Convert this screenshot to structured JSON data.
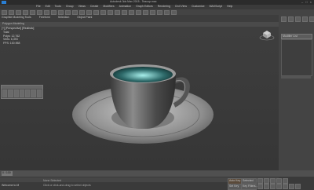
{
  "titlebar": {
    "title": "Autodesk 3ds Max 2015 - Teacup.max"
  },
  "menu": [
    "File",
    "Edit",
    "Tools",
    "Group",
    "Views",
    "Create",
    "Modifiers",
    "Animation",
    "Graph Editors",
    "Rendering",
    "Civil View",
    "Customize",
    "MAXScript",
    "Help"
  ],
  "ribbon": {
    "tabs": [
      "Graphite Modeling Tools",
      "Freeform",
      "Selection",
      "Object Paint"
    ],
    "sub_label": "Polygon Modeling"
  },
  "viewport": {
    "label": "[+] [Perspective] [Realistic]",
    "stats": [
      {
        "key": "Total",
        "value": ""
      },
      {
        "key": "Polys:",
        "value": "12,762"
      },
      {
        "key": "Verts:",
        "value": "6,393"
      },
      {
        "key": "FPS:",
        "value": "100.958"
      }
    ]
  },
  "command_panel": {
    "dropdown": "Modifier List"
  },
  "statusbar": {
    "timeline_position": "0 / 100",
    "welcome": "Welcome to M",
    "prompt": "Click or click-and-drag to select objects",
    "selection": "None Selected",
    "autokey": "Auto Key",
    "selected_dropdown": "Selected",
    "set_key": "Set Key",
    "key_filters": "Key Filters..."
  },
  "colors": {
    "accent": "#0e8cff",
    "liquid": "#8fe3e0"
  }
}
